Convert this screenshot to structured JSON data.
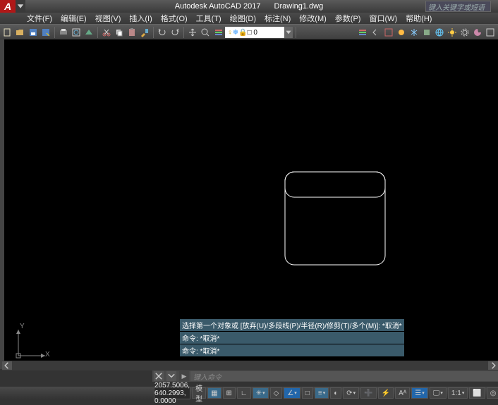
{
  "app": {
    "name": "Autodesk AutoCAD 2017",
    "document": "Drawing1.dwg",
    "logo": "A"
  },
  "search": {
    "placeholder": "键入关键字或短语"
  },
  "menu": {
    "items": [
      {
        "label": "文件(F)",
        "id": "file"
      },
      {
        "label": "编辑(E)",
        "id": "edit"
      },
      {
        "label": "视图(V)",
        "id": "view"
      },
      {
        "label": "插入(I)",
        "id": "insert"
      },
      {
        "label": "格式(O)",
        "id": "format"
      },
      {
        "label": "工具(T)",
        "id": "tools"
      },
      {
        "label": "绘图(D)",
        "id": "draw"
      },
      {
        "label": "标注(N)",
        "id": "dimension"
      },
      {
        "label": "修改(M)",
        "id": "modify"
      },
      {
        "label": "参数(P)",
        "id": "parametric"
      },
      {
        "label": "窗口(W)",
        "id": "window"
      },
      {
        "label": "帮助(H)",
        "id": "help"
      }
    ]
  },
  "toolbar": {
    "btns_left": [
      "new",
      "open",
      "save",
      "saveas",
      "plot",
      "plot-preview",
      "publish",
      "cut",
      "copy",
      "paste",
      "match",
      "undo",
      "redo",
      "pan",
      "zoom"
    ],
    "layer": {
      "display": "□ 0"
    },
    "btns_right": [
      "layer-state",
      "layer-prev",
      "layer-iso",
      "layer-off",
      "freeze",
      "block",
      "globe",
      "sun",
      "cog",
      "palette",
      "fullscreen"
    ]
  },
  "canvas": {
    "ucs": {
      "x": "X",
      "y": "Y"
    }
  },
  "cmd_history": [
    "选择第一个对象或 [放弃(U)/多段线(P)/半径(R)/修剪(T)/多个(M)]: *取消*",
    "命令: *取消*",
    "命令: *取消*"
  ],
  "cmd_input": {
    "placeholder": "键入命令",
    "icon": "▶"
  },
  "status": {
    "coords": "2057.5006, 640.2993, 0.0000",
    "model_label": "模型",
    "buttons": [
      "grid",
      "snap",
      "ortho",
      "polar",
      "isoplane",
      "otrack",
      "osnap",
      "lineweight",
      "transparency",
      "cycling",
      "dyn",
      "quick",
      "annotation",
      "workspace",
      "monitor",
      "units",
      "clean",
      "isolate",
      "hardware",
      "props"
    ]
  }
}
